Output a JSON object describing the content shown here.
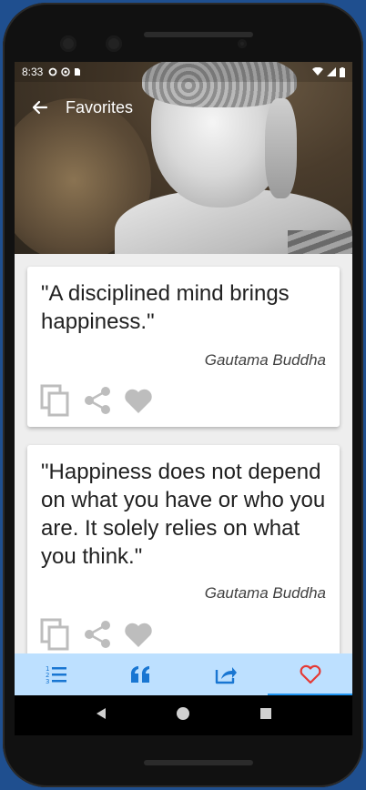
{
  "status_bar": {
    "time": "8:33"
  },
  "toolbar": {
    "title": "Favorites"
  },
  "quotes": [
    {
      "text": "\"A disciplined mind brings happiness.\"",
      "author": "Gautama Buddha"
    },
    {
      "text": "\"Happiness does not depend on what you have or who you are. It solely relies on what you think.\"",
      "author": "Gautama Buddha"
    }
  ],
  "bottom_nav": {
    "tabs": [
      {
        "icon": "list-numbered-icon",
        "active": false
      },
      {
        "icon": "quote-icon",
        "active": false
      },
      {
        "icon": "share-square-icon",
        "active": false
      },
      {
        "icon": "heart-outline-icon",
        "active": true
      }
    ]
  },
  "colors": {
    "accent": "#1976d2",
    "active_tab": "#e53935",
    "bottom_nav_bg": "#bde0ff",
    "action_icon": "#bdbdbd"
  }
}
